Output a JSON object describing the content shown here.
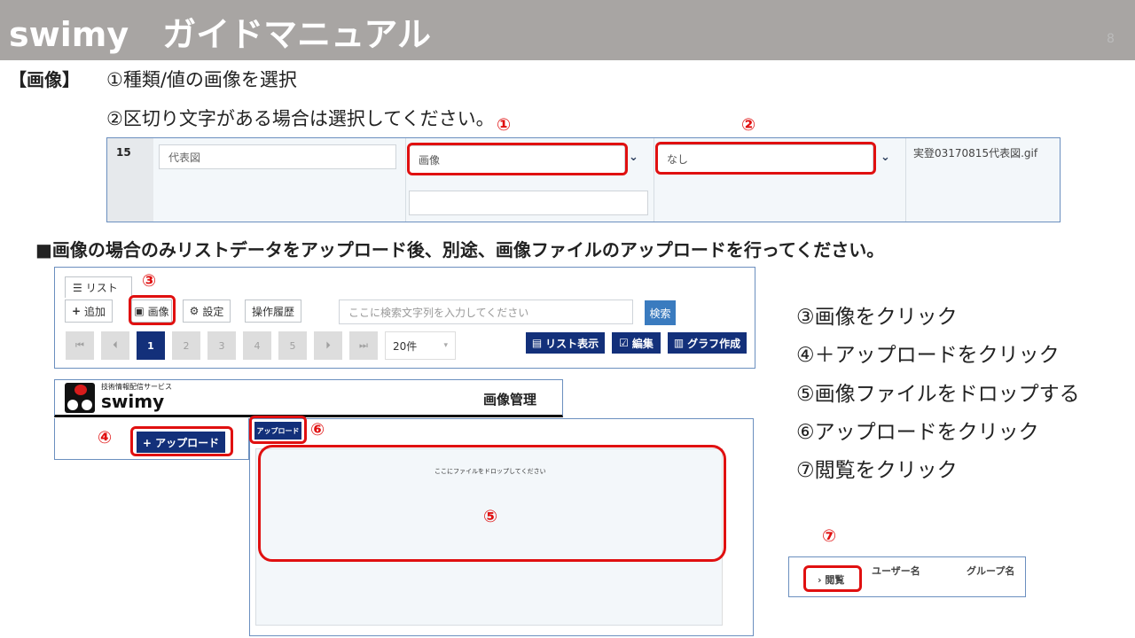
{
  "header": {
    "title": "swimy　ガイドマニュアル",
    "page_number": "8"
  },
  "section_label": "【画像】",
  "steps_top": [
    "①種類/値の画像を選択",
    "②区切り文字がある場合は選択してください。"
  ],
  "row": {
    "number": "15",
    "name_placeholder": "代表図",
    "type_value": "画像",
    "separator_value": "なし",
    "file_name": "実登03170815代表図.gif"
  },
  "markers": {
    "m1": "①",
    "m2": "②",
    "m3": "③",
    "m4": "④",
    "m5": "⑤",
    "m6": "⑥",
    "m7": "⑦"
  },
  "notice": "■画像の場合のみリストデータをアップロード後、別途、画像ファイルのアップロードを行ってください。",
  "toolbar": {
    "list_tab": "リスト",
    "add": "追加",
    "image": "画像",
    "settings": "設定",
    "history": "操作履歴",
    "search_placeholder": "ここに検索文字列を入力してください",
    "search_button": "検索",
    "pages": [
      "1",
      "2",
      "3",
      "4",
      "5"
    ],
    "per_page": "20件",
    "list_view": "リスト表示",
    "edit": "編集",
    "graph": "グラフ作成"
  },
  "image_manager": {
    "brand_sub": "技術情報配信サービス",
    "brand": "swimy",
    "title": "画像管理",
    "upload_plus": "+ アップロード",
    "upload_small": "アップロード",
    "drop_text": "ここにファイルをドロップしてください"
  },
  "steps_right": [
    "③画像をクリック",
    "④＋アップロードをクリック",
    "⑤画像ファイルをドロップする",
    "⑥アップロードをクリック",
    "⑦閲覧をクリック"
  ],
  "browse_panel": {
    "browse": "閲覧",
    "user_col": "ユーザー名",
    "group_col": "グループ名"
  },
  "colors": {
    "accent_red": "#e01010",
    "navy": "#13307a",
    "header_gray": "#a8a5a3"
  }
}
